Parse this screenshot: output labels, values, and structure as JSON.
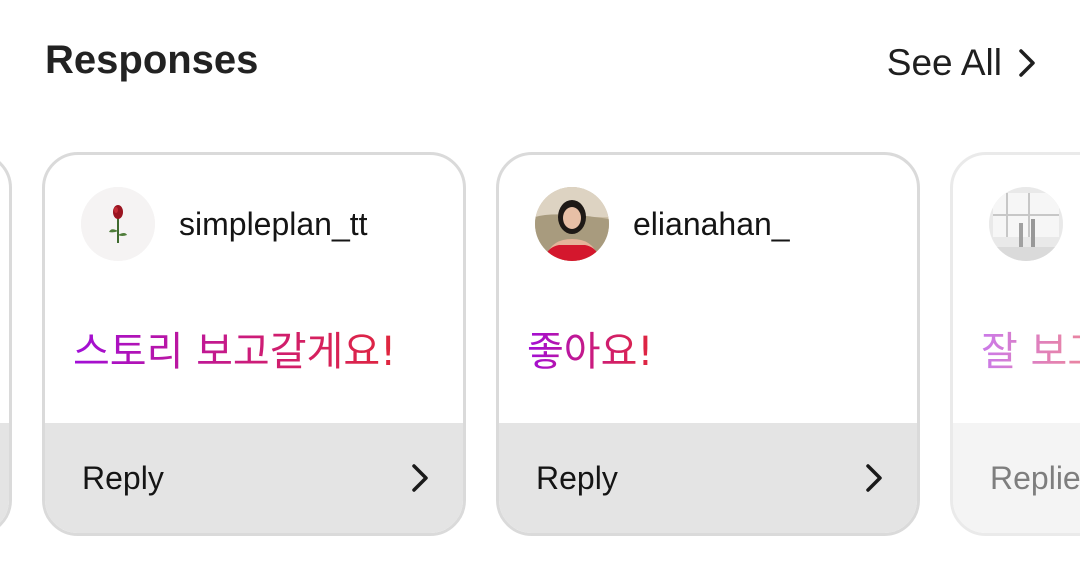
{
  "header": {
    "title": "Responses",
    "see_all_label": "See All"
  },
  "cards": [
    {
      "username": "simpleplan_tt",
      "avatar_icon": "rose-avatar",
      "message": "스토리 보고갈게요!",
      "action_label": "Reply"
    },
    {
      "username": "elianahan_",
      "avatar_icon": "profile-photo-avatar",
      "message": "좋아요!",
      "action_label": "Reply"
    },
    {
      "username": "",
      "avatar_icon": "grayscale-photo-avatar",
      "message": "잘 보고",
      "action_label": "Replie"
    }
  ],
  "colors": {
    "message_gradient_start": "#a10ed8",
    "message_gradient_end": "#e0263c",
    "footer_bg": "#e4e4e4",
    "card_border": "#dadada"
  }
}
